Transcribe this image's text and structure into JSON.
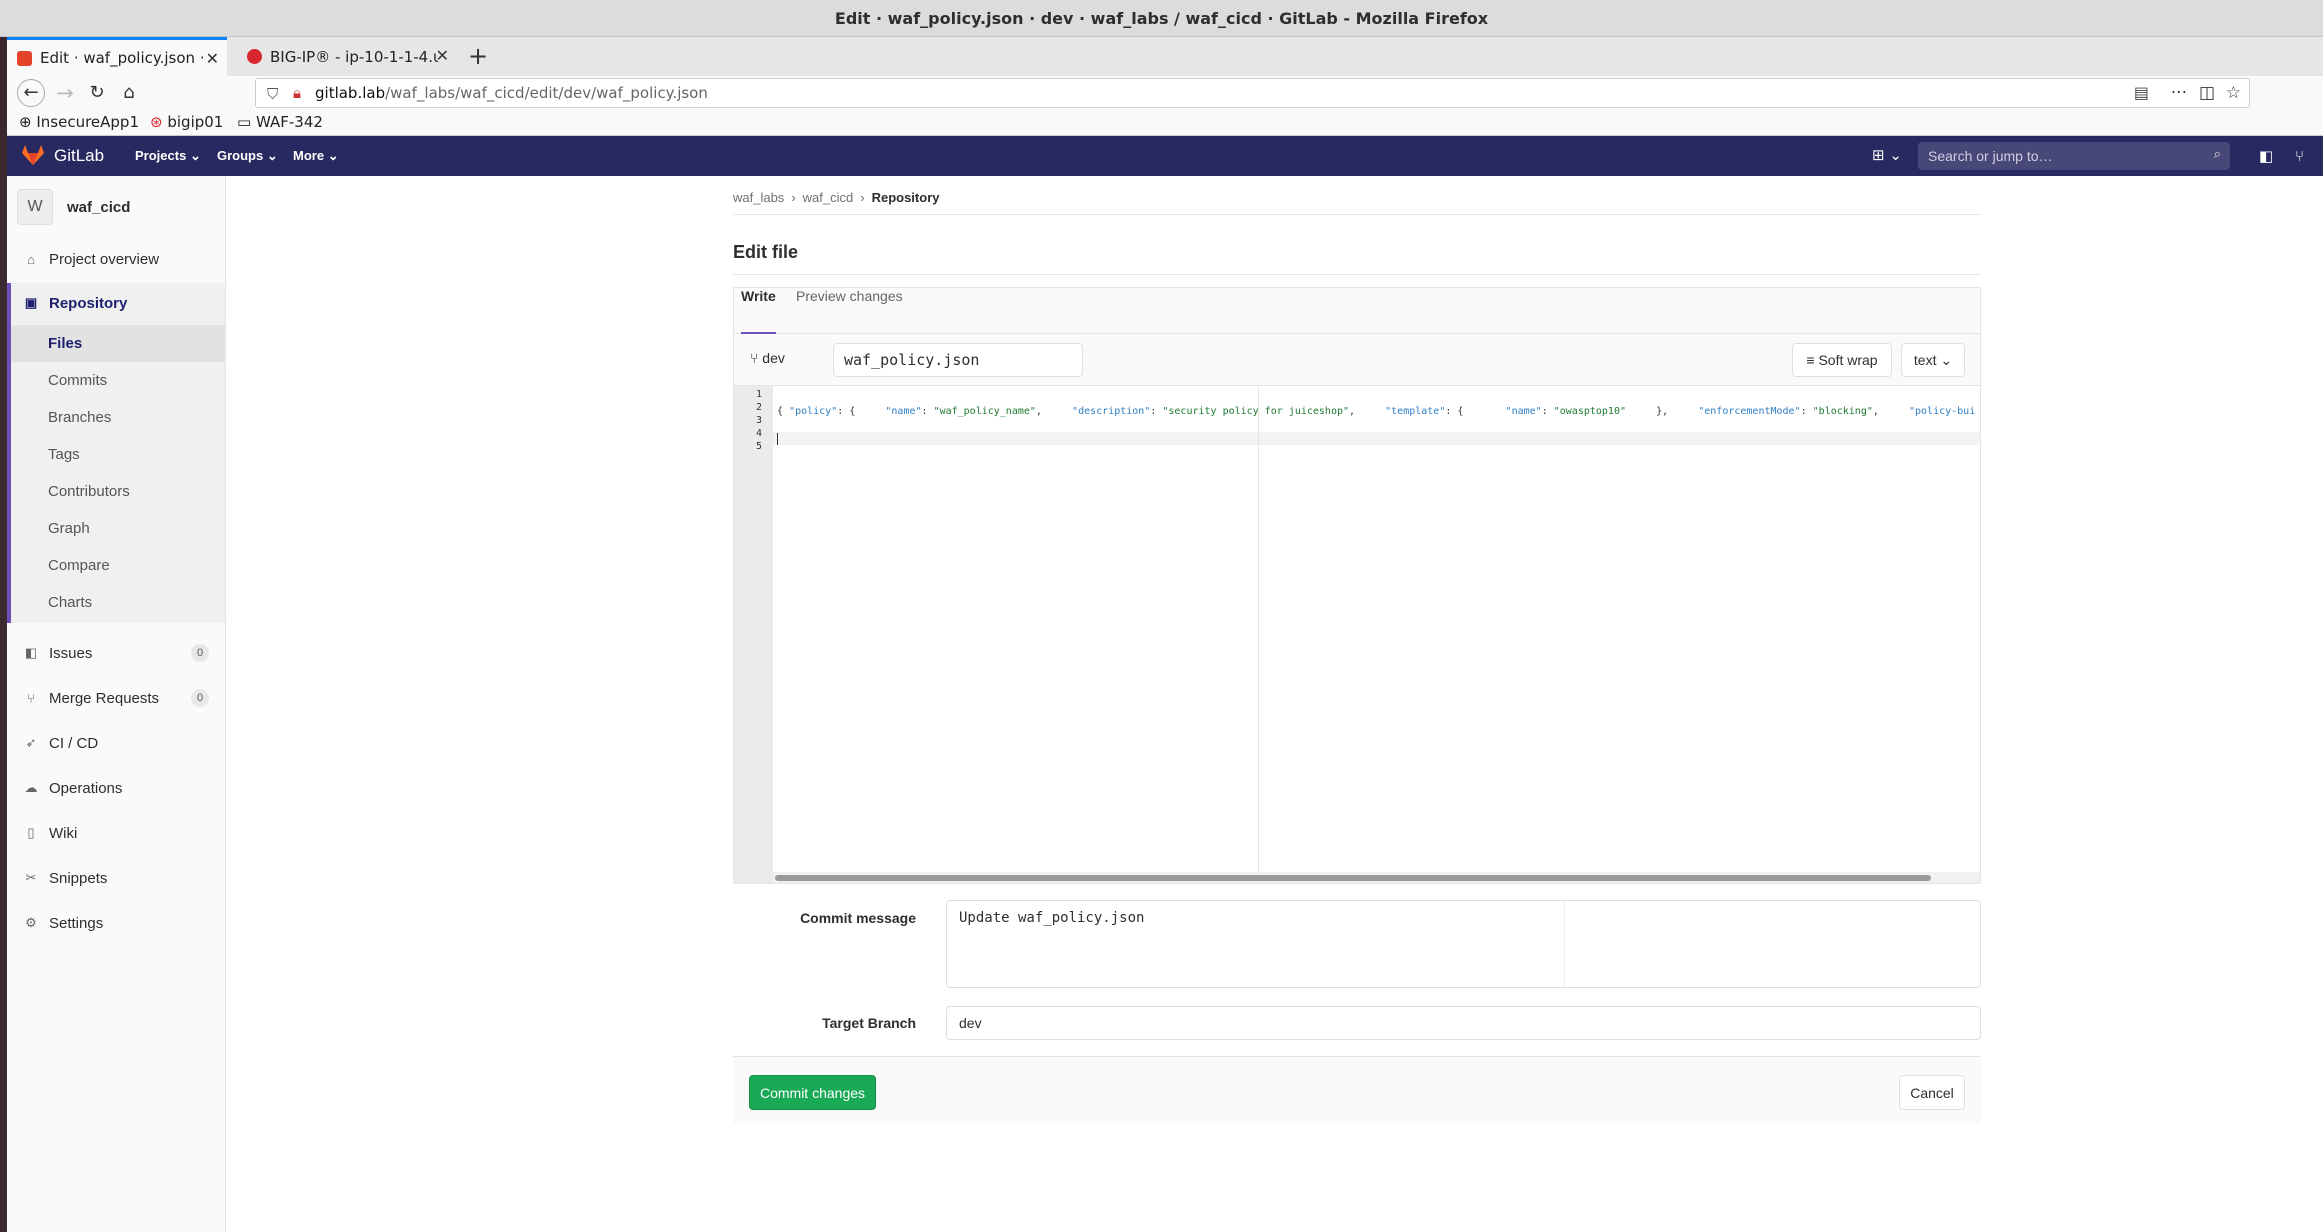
{
  "window": {
    "title": "Edit · waf_policy.json · dev · waf_labs / waf_cicd · GitLab - Mozilla Firefox"
  },
  "browser": {
    "tabs": [
      {
        "label": "Edit · waf_policy.json ·",
        "active": true
      },
      {
        "label": "BIG-IP® - ip-10-1-1-4.u",
        "active": false
      }
    ],
    "url_host": "gitlab.lab",
    "url_path": "/waf_labs/waf_cicd/edit/dev/waf_policy.json",
    "bookmarks": [
      "InsecureApp1",
      "bigip01",
      "WAF-342"
    ]
  },
  "gitlab": {
    "brand": "GitLab",
    "nav": [
      "Projects",
      "Groups",
      "More"
    ],
    "search_placeholder": "Search or jump to…",
    "accent_color": "#292961"
  },
  "sidebar": {
    "project_initial": "W",
    "project_name": "waf_cicd",
    "top_items": [
      {
        "label": "Project overview",
        "icon": "home-icon"
      }
    ],
    "repository": {
      "label": "Repository",
      "icon": "book-icon",
      "subitems": [
        "Files",
        "Commits",
        "Branches",
        "Tags",
        "Contributors",
        "Graph",
        "Compare",
        "Charts"
      ],
      "active_subitem": "Files"
    },
    "items": [
      {
        "label": "Issues",
        "icon": "issues-icon",
        "count": "0"
      },
      {
        "label": "Merge Requests",
        "icon": "merge-request-icon",
        "count": "0"
      },
      {
        "label": "CI / CD",
        "icon": "rocket-icon"
      },
      {
        "label": "Operations",
        "icon": "cloud-icon"
      },
      {
        "label": "Wiki",
        "icon": "wiki-icon"
      },
      {
        "label": "Snippets",
        "icon": "scissors-icon"
      },
      {
        "label": "Settings",
        "icon": "gear-icon"
      }
    ]
  },
  "main": {
    "breadcrumb": [
      "waf_labs",
      "waf_cicd",
      "Repository"
    ],
    "title": "Edit file",
    "tabs": [
      "Write",
      "Preview changes"
    ],
    "branch": "dev",
    "filename": "waf_policy.json",
    "soft_wrap_label": "Soft wrap",
    "mode_label": "text",
    "line_numbers": [
      "1",
      "2",
      "3",
      "4",
      "5"
    ],
    "code_line3_tokens": [
      {
        "t": "{ ",
        "c": ""
      },
      {
        "t": "\"policy\"",
        "c": "k"
      },
      {
        "t": ": {     ",
        "c": ""
      },
      {
        "t": "\"name\"",
        "c": "k"
      },
      {
        "t": ": ",
        "c": ""
      },
      {
        "t": "\"waf_policy_name\"",
        "c": "s"
      },
      {
        "t": ",     ",
        "c": ""
      },
      {
        "t": "\"description\"",
        "c": "k"
      },
      {
        "t": ": ",
        "c": ""
      },
      {
        "t": "\"security policy for juiceshop\"",
        "c": "s"
      },
      {
        "t": ",     ",
        "c": ""
      },
      {
        "t": "\"template\"",
        "c": "k"
      },
      {
        "t": ": {       ",
        "c": ""
      },
      {
        "t": "\"name\"",
        "c": "k"
      },
      {
        "t": ": ",
        "c": ""
      },
      {
        "t": "\"owasptop10\"",
        "c": "s"
      },
      {
        "t": "     },     ",
        "c": ""
      },
      {
        "t": "\"enforcementMode\"",
        "c": "k"
      },
      {
        "t": ": ",
        "c": ""
      },
      {
        "t": "\"blocking\"",
        "c": "s"
      },
      {
        "t": ",     ",
        "c": ""
      },
      {
        "t": "\"policy-bui",
        "c": "k"
      }
    ],
    "commit_message_label": "Commit message",
    "commit_message": "Update waf_policy.json",
    "target_branch_label": "Target Branch",
    "target_branch": "dev",
    "commit_button": "Commit changes",
    "cancel_button": "Cancel"
  }
}
